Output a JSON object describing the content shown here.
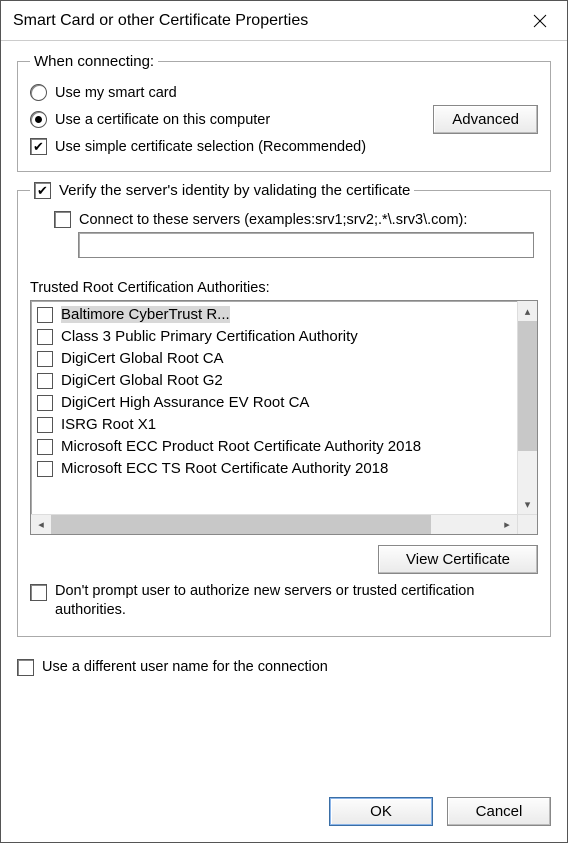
{
  "title": "Smart Card or other Certificate Properties",
  "connecting": {
    "legend": "When connecting:",
    "use_smartcard_label": "Use my smart card",
    "use_computer_cert_label": "Use a certificate on this computer",
    "simple_selection_label": "Use simple certificate selection (Recommended)",
    "advanced_label": "Advanced"
  },
  "verify_label": "Verify the server's identity by validating the certificate",
  "connect_servers_label": "Connect to these servers (examples:srv1;srv2;.*\\.srv3\\.com):",
  "servers_value": "",
  "ca_heading": "Trusted Root Certification Authorities:",
  "ca_items": [
    "Baltimore CyberTrust R...",
    "Class 3 Public Primary Certification Authority",
    "DigiCert Global Root CA",
    "DigiCert Global Root G2",
    "DigiCert High Assurance EV Root CA",
    "ISRG Root X1",
    "Microsoft ECC Product Root Certificate Authority 2018",
    "Microsoft ECC TS Root Certificate Authority 2018"
  ],
  "view_cert_label": "View Certificate",
  "dont_prompt_label": "Don't prompt user to authorize new servers or trusted certification authorities.",
  "diff_user_label": "Use a different user name for the connection",
  "ok_label": "OK",
  "cancel_label": "Cancel"
}
